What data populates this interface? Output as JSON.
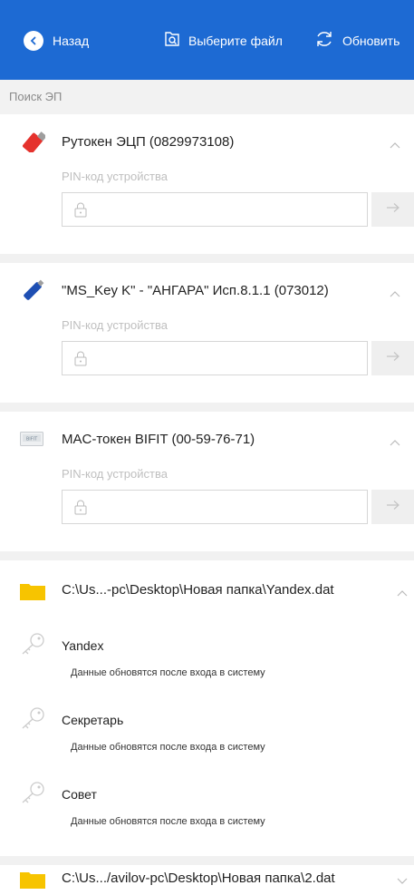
{
  "header": {
    "back_label": "Назад",
    "choose_file_label": "Выберите файл",
    "refresh_label": "Обновить",
    "accent_color": "#1d6ad3"
  },
  "search": {
    "label": "Поиск ЭП"
  },
  "tokens": [
    {
      "title": "Рутокен ЭЦП (0829973108)",
      "icon": "usb-token-red-icon",
      "pin_label": "PIN-код устройства"
    },
    {
      "title": "\"MS_Key K\" - \"АНГАРА\" Исп.8.1.1 (073012)",
      "icon": "usb-token-blue-icon",
      "pin_label": "PIN-код устройства"
    },
    {
      "title": "MAC-токен BIFIT (00-59-76-71)",
      "icon": "mac-token-icon",
      "icon_text": "BIFIT",
      "pin_label": "PIN-код устройства"
    }
  ],
  "files": [
    {
      "path": "C:\\Us...-pc\\Desktop\\Новая папка\\Yandex.dat",
      "expanded": true,
      "keys": [
        {
          "name": "Yandex",
          "status": "Данные обновятся после входа в систему"
        },
        {
          "name": "Секретарь",
          "status": "Данные обновятся после входа в систему"
        },
        {
          "name": "Совет",
          "status": "Данные обновятся после входа в систему"
        }
      ]
    },
    {
      "path": "C:\\Us.../avilov-pc\\Desktop\\Новая папка\\2.dat",
      "expanded": false
    }
  ]
}
